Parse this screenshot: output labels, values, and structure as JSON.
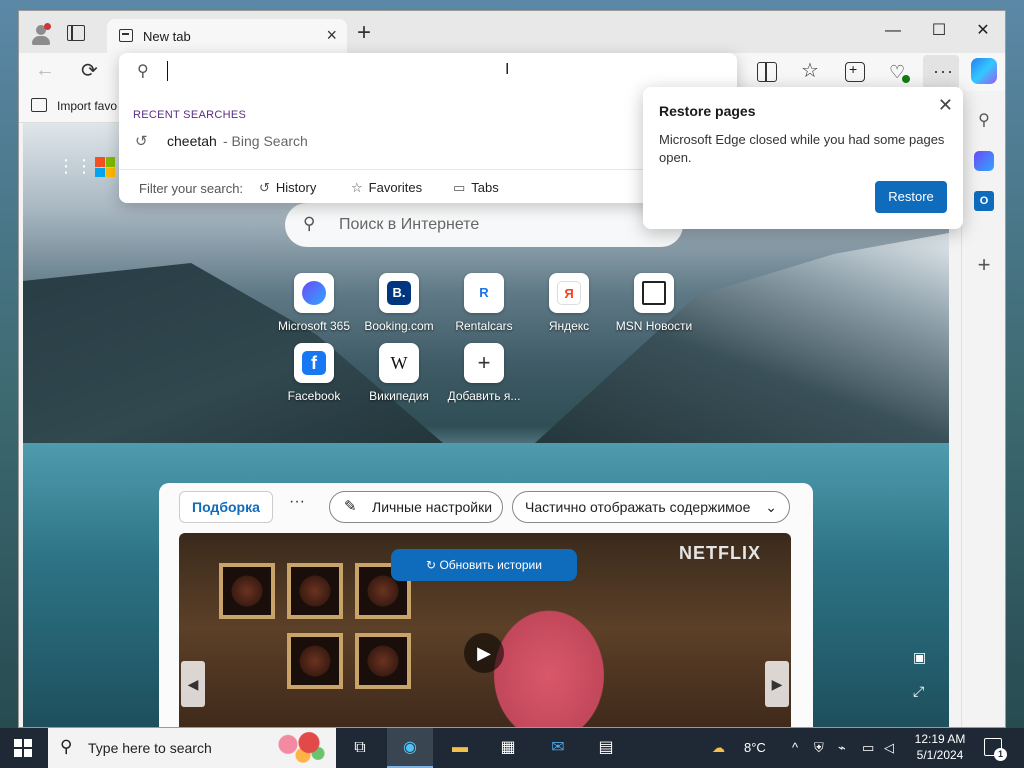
{
  "browser": {
    "tab": {
      "title": "New tab",
      "favicon": "newtab-icon"
    },
    "window_controls": {
      "minimize": "—",
      "maximize": "☐",
      "close": "✕"
    },
    "favorites_bar": {
      "import_label": "Import favo"
    }
  },
  "address_dropdown": {
    "placeholder": "",
    "recent_title": "RECENT SEARCHES",
    "recent": [
      {
        "term": "cheetah",
        "source": "- Bing Search"
      }
    ],
    "filter_label": "Filter your search:",
    "filters": [
      "History",
      "Favorites",
      "Tabs"
    ]
  },
  "restore_popup": {
    "title": "Restore pages",
    "message": "Microsoft Edge closed while you had some pages open.",
    "button": "Restore"
  },
  "newtab": {
    "search_placeholder": "Поиск в Интернете",
    "quick_links": [
      {
        "label": "Microsoft 365",
        "icon": "m365-icon"
      },
      {
        "label": "Booking.com",
        "icon": "booking-icon",
        "glyph": "B."
      },
      {
        "label": "Rentalcars",
        "icon": "rentalcars-icon",
        "glyph": "R"
      },
      {
        "label": "Яндекс",
        "icon": "yandex-icon",
        "glyph": "Я"
      },
      {
        "label": "MSN Новости",
        "icon": "msn-news-icon"
      },
      {
        "label": "Facebook",
        "icon": "facebook-icon",
        "glyph": "f"
      },
      {
        "label": "Википедия",
        "icon": "wikipedia-icon",
        "glyph": "W"
      },
      {
        "label": "Добавить я...",
        "icon": "add-icon",
        "glyph": "+"
      }
    ],
    "feed": {
      "tab_label": "Подборка",
      "more": "···",
      "personalize": "Личные настройки",
      "display": "Частично отображать содержимое",
      "refresh_stories": "Обновить истории",
      "brand": "NETFLIX"
    }
  },
  "taskbar": {
    "search_placeholder": "Type here to search",
    "weather": "8°C",
    "time": "12:19 AM",
    "date": "5/1/2024",
    "notification_count": "1"
  },
  "colors": {
    "accent": "#0f6cbd",
    "taskbar": "#1f2935"
  }
}
